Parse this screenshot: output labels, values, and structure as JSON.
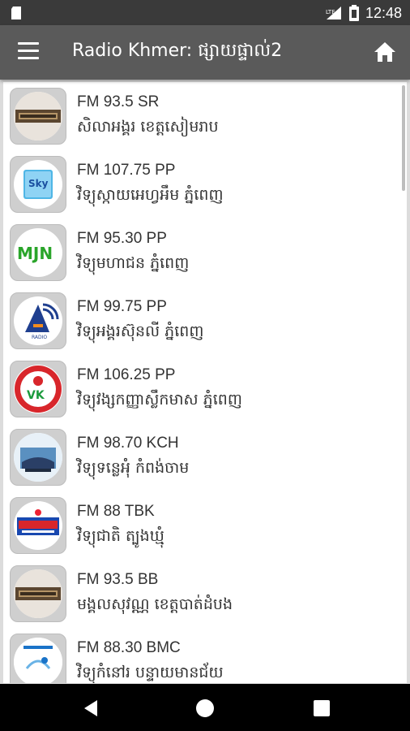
{
  "status": {
    "time": "12:48",
    "network": "LTE"
  },
  "appbar": {
    "title": "Radio Khmer: ផ្សាយផ្ទាល់2",
    "menu_icon": "menu-icon",
    "home_icon": "home-icon"
  },
  "stations": [
    {
      "title": "FM 93.5 SR",
      "subtitle": "សិលាអង្គរ ខេត្តសៀមរាប",
      "logo": "brown-banner"
    },
    {
      "title": "FM 107.75 PP",
      "subtitle": "វិទ្យុស្កាយអេហ្វអឹម ភ្នំពេញ",
      "logo": "sky"
    },
    {
      "title": "FM 95.30 PP",
      "subtitle": "វិទ្យុមហាជន ភ្នំពេញ",
      "logo": "mjn"
    },
    {
      "title": "FM 99.75 PP",
      "subtitle": "វិទ្យុអង្គរស៊ុនលី ភ្នំពេញ",
      "logo": "angkor"
    },
    {
      "title": "FM 106.25 PP",
      "subtitle": "វិទ្យុវង្សកញ្ញាស្លឹកមាស ភ្នំពេញ",
      "logo": "vkk"
    },
    {
      "title": "FM 98.70 KCH",
      "subtitle": "វិទ្យុទន្លេអុំ កំពង់ចាម",
      "logo": "boat"
    },
    {
      "title": "FM 88 TBK",
      "subtitle": "វិទ្យុជាតិ ត្បូងឃ្មុំ",
      "logo": "national"
    },
    {
      "title": "FM 93.5 BB",
      "subtitle": "មង្គលសុវណ្ណ ខេត្តបាត់ដំបង",
      "logo": "brown-banner"
    },
    {
      "title": "FM 88.30 BMC",
      "subtitle": "វិទ្យុកំនៅរ បន្ទាយមានជ័យ",
      "logo": "bmc"
    }
  ],
  "nav": {
    "back_icon": "back-icon",
    "home_icon": "home-circle-icon",
    "recents_icon": "recents-icon"
  }
}
